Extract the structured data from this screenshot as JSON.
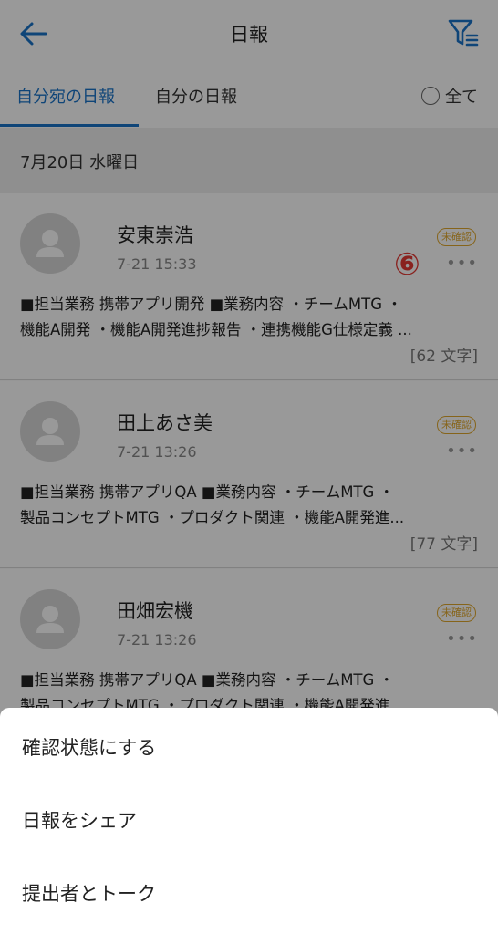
{
  "header": {
    "title": "日報",
    "back_icon": "arrow-left-icon",
    "filter_icon": "filter-list-icon",
    "accent": "#1a73c9"
  },
  "tabs": {
    "tab_to_me": "自分宛の日報",
    "tab_mine": "自分の日報",
    "all_label": "全て"
  },
  "date_label": "7月20日 水曜日",
  "reports": [
    {
      "name": "安東崇浩",
      "time": "7-21 15:33",
      "status": "未確認",
      "line1": "■担当業務 携帯アプリ開発 ■業務内容 ・チームMTG ・",
      "line2": "機能A開発 ・機能A開発進捗報告 ・連携機能G仕様定義 ...",
      "count": "[62 文字]"
    },
    {
      "name": "田上あさ美",
      "time": "7-21 13:26",
      "status": "未確認",
      "line1": "■担当業務 携帯アプリQA ■業務内容 ・チームMTG ・",
      "line2": "製品コンセプトMTG ・プロダクト関連 ・機能A開発進...",
      "count": "[77 文字]"
    },
    {
      "name": "田畑宏機",
      "time": "7-21 13:26",
      "status": "未確認",
      "line1": "■担当業務 携帯アプリQA ■業務内容 ・チームMTG ・",
      "line2": "製品コンセプトMTG ・プロダクト関連 ・機能A開発進...",
      "count": ""
    }
  ],
  "more_icon": "more-horizontal-icon",
  "annotation_marker": "⑥",
  "sheet": {
    "confirm": "確認状態にする",
    "share": "日報をシェア",
    "talk": "提出者とトーク"
  }
}
